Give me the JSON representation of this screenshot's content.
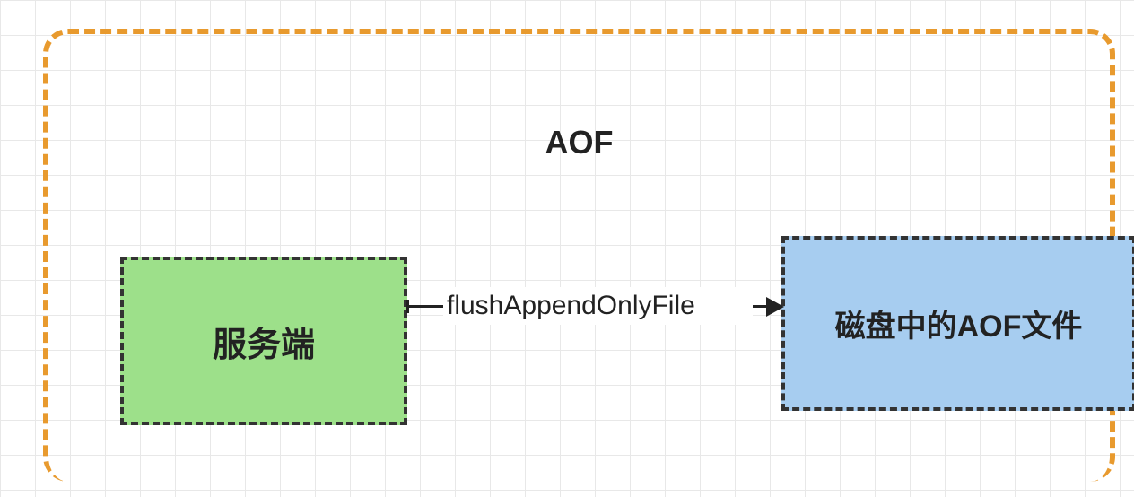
{
  "diagram": {
    "title": "AOF",
    "server_box_label": "服务端",
    "aof_file_box_label": "磁盘中的AOF文件",
    "arrow_label": "flushAppendOnlyFile"
  },
  "colors": {
    "container_border": "#e89a2e",
    "server_bg": "#9de08a",
    "aof_file_bg": "#a7cdf0",
    "box_border": "#333333",
    "grid": "#e8e8e8"
  }
}
